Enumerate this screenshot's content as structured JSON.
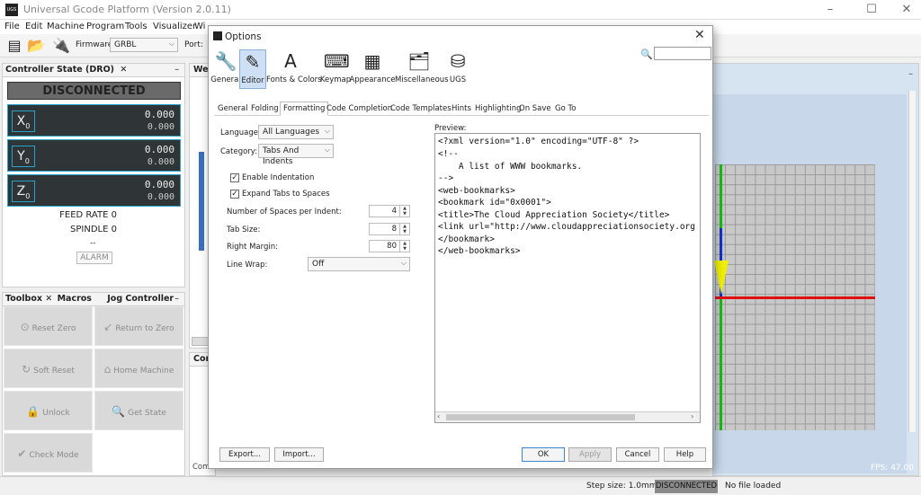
{
  "window": {
    "title": "Universal Gcode Platform (Version 2.0.11)"
  },
  "menu": [
    "File",
    "Edit",
    "Machine",
    "Program",
    "Tools",
    "Visualizer",
    "Wi"
  ],
  "toolbar": {
    "firmware_label": "Firmware:",
    "firmware_value": "GRBL",
    "port_label": "Port:"
  },
  "dro": {
    "tab": "Controller State (DRO)",
    "state": "DISCONNECTED",
    "axes": [
      {
        "letter": "X",
        "sub": "0",
        "work": "0.000",
        "machine": "0.000"
      },
      {
        "letter": "Y",
        "sub": "0",
        "work": "0.000",
        "machine": "0.000"
      },
      {
        "letter": "Z",
        "sub": "0",
        "work": "0.000",
        "machine": "0.000"
      }
    ],
    "feed_label": "FEED RATE",
    "feed_value": "0",
    "spindle_label": "SPINDLE",
    "spindle_value": "0",
    "dash": "--",
    "alarm": "ALARM"
  },
  "toolbox": {
    "tabs": [
      "Toolbox",
      "Macros",
      "Jog Controller"
    ],
    "buttons": [
      "Reset Zero",
      "Return to Zero",
      "Soft Reset",
      "Home Machine",
      "Unlock",
      "Get State",
      "Check Mode"
    ]
  },
  "side_tabs": {
    "welcome": "Welc",
    "console": "Cons",
    "command": "Com"
  },
  "visualizer": {
    "fps": "FPS: 47.00"
  },
  "dialog": {
    "title": "Options",
    "search_value": "",
    "categories": [
      "General",
      "Editor",
      "Fonts & Colors",
      "Keymap",
      "Appearance",
      "Miscellaneous",
      "UGS"
    ],
    "selected_category": "Editor",
    "subtabs": [
      "General",
      "Folding",
      "Formatting",
      "Code Completion",
      "Code Templates",
      "Hints",
      "Highlighting",
      "On Save",
      "Go To"
    ],
    "selected_subtab": "Formatting",
    "language_label": "Language:",
    "language_value": "All Languages",
    "category_label": "Category:",
    "category_value": "Tabs And Indents",
    "enable_indentation": "Enable Indentation",
    "expand_tabs": "Expand Tabs to Spaces",
    "spaces_label": "Number of Spaces per Indent:",
    "spaces_value": "4",
    "tab_size_label": "Tab Size:",
    "tab_size_value": "8",
    "right_margin_label": "Right Margin:",
    "right_margin_value": "80",
    "line_wrap_label": "Line Wrap:",
    "line_wrap_value": "Off",
    "preview_label": "Preview:",
    "preview_lines": [
      "<?xml version=\"1.0\" encoding=\"UTF-8\" ?>",
      "<!--",
      "    A list of WWW bookmarks.",
      "-->",
      "<web-bookmarks>",
      "<bookmark id=\"0x0001\">",
      "<title>The Cloud Appreciation Society</title>",
      "<link url=\"http://www.cloudappreciationsociety.org",
      "</bookmark>",
      "</web-bookmarks>"
    ],
    "buttons": {
      "export": "Export...",
      "import": "Import...",
      "ok": "OK",
      "apply": "Apply",
      "cancel": "Cancel",
      "help": "Help"
    }
  },
  "status": {
    "step_size": "Step size: 1.0mm",
    "state": "DISCONNECTED",
    "file": "No file loaded"
  },
  "colors": {
    "accent": "#29a2c7",
    "x_axis": "#e01010",
    "y_axis": "#10c010",
    "z_axis": "#1030d0",
    "tool": "#f0f000"
  }
}
